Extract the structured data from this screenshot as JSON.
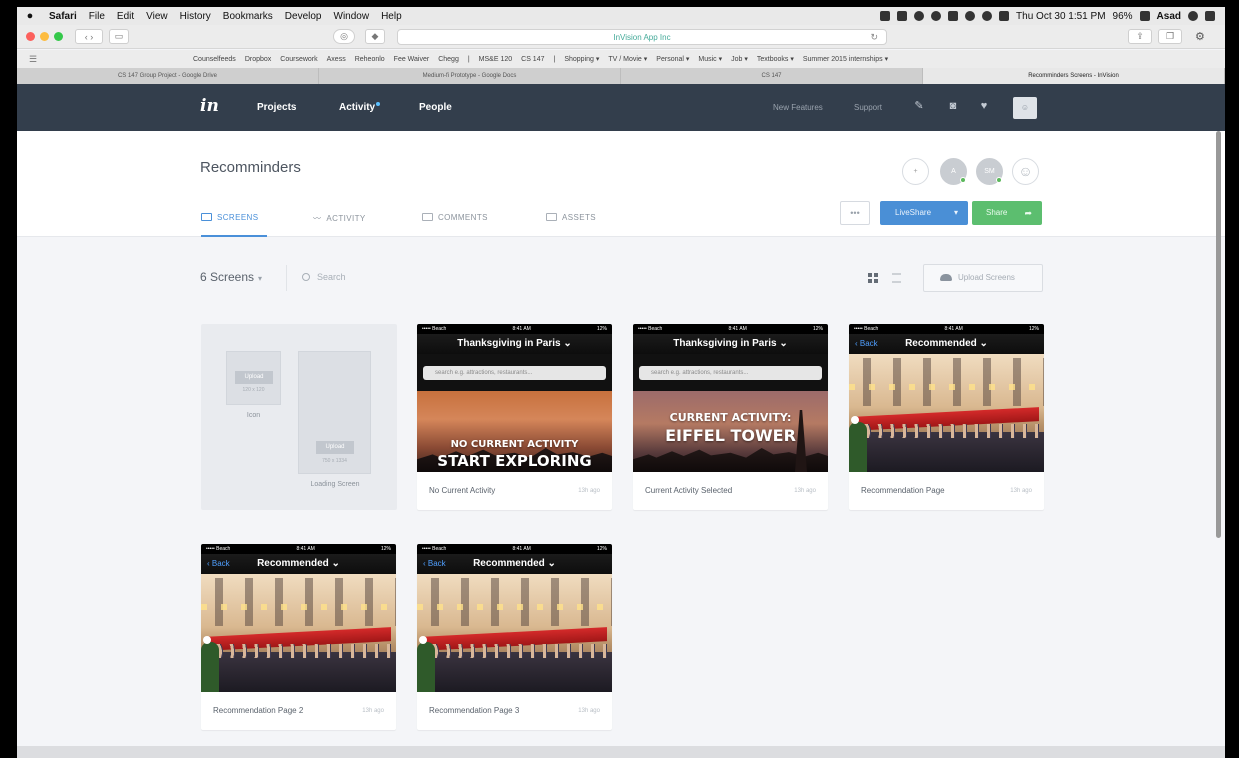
{
  "menubar": {
    "apple": "",
    "items": [
      "Safari",
      "File",
      "Edit",
      "View",
      "History",
      "Bookmarks",
      "Develop",
      "Window",
      "Help"
    ],
    "status": "Thu Oct 30  1:51 PM",
    "battery": "96%",
    "user": "Asad"
  },
  "browser": {
    "url": "InVision App Inc",
    "bookmarks": [
      "Counselfeeds",
      "Dropbox",
      "Coursework",
      "Axess",
      "Reheonlo",
      "Fee Waiver",
      "Chegg",
      "|",
      "MS&E 120",
      "CS 147",
      "|",
      "Shopping ▾",
      "TV / Movie ▾",
      "Personal ▾",
      "Music ▾",
      "Job ▾",
      "Textbooks ▾",
      "Summer 2015 internships ▾"
    ],
    "tabs": [
      "CS 147 Group Project - Google Drive",
      "Medium-fi Prototype - Google Docs",
      "CS 147",
      "Recomminders Screens - InVision"
    ]
  },
  "appnav": {
    "logo": "in",
    "projects": "Projects",
    "activity": "Activity",
    "people": "People",
    "new_features": "New Features",
    "support": "Support"
  },
  "project": {
    "title": "Recomminders",
    "avatars": [
      "+",
      "A",
      "SM"
    ],
    "tabs": {
      "screens": "SCREENS",
      "activity": "ACTIVITY",
      "comments": "COMMENTS",
      "assets": "ASSETS"
    },
    "more": "•••",
    "liveshare": "LiveShare",
    "share": "Share"
  },
  "filters": {
    "count": "6 Screens",
    "search_placeholder": "Search",
    "upload": "Upload Screens"
  },
  "placeholder": {
    "upload": "Upload",
    "icon_size": "120 x 120",
    "icon_label": "Icon",
    "loading_size": "750 x 1334",
    "loading_label": "Loading Screen"
  },
  "screens": [
    {
      "name": "No Current Activity",
      "time": "13h ago",
      "header": "Thanksgiving in Paris",
      "search": "search e.g. attractions, restaurants...",
      "line1": "NO CURRENT ACTIVITY",
      "line2": "START EXPLORING"
    },
    {
      "name": "Current Activity Selected",
      "time": "13h ago",
      "header": "Thanksgiving in Paris",
      "search": "search e.g. attractions, restaurants...",
      "line1": "CURRENT ACTIVITY:",
      "line2": "EIFFEL TOWER"
    },
    {
      "name": "Recommendation Page",
      "time": "13h ago",
      "header": "Recommended",
      "back": "Back"
    },
    {
      "name": "Recommendation Page 2",
      "time": "13h ago",
      "header": "Recommended",
      "back": "Back"
    },
    {
      "name": "Recommendation Page 3",
      "time": "13h ago",
      "header": "Recommended",
      "back": "Back"
    }
  ],
  "mobile_status": {
    "carrier": "••••• Beach",
    "time": "8:41 AM",
    "battery": "12%"
  },
  "colors": {
    "nav": "#333e4c",
    "accent": "#4a90d9",
    "share": "#5cbe6f"
  }
}
